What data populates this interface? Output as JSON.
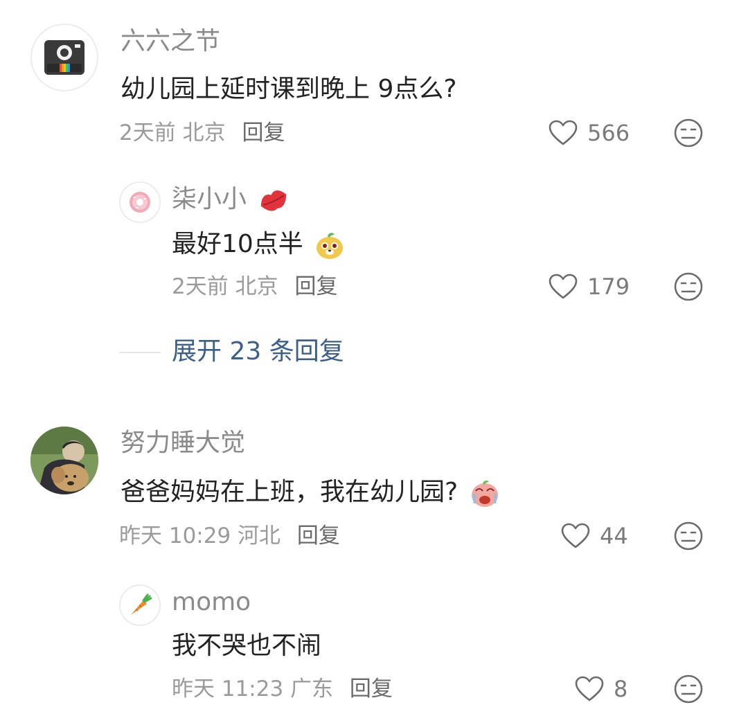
{
  "comments": [
    {
      "user": "六六之节",
      "text": "幼儿园上延时课到晚上 9点么?",
      "time": "2天前",
      "location": "北京",
      "reply_label": "回复",
      "likes": "566"
    },
    {
      "user": "柒小小",
      "text": "最好10点半",
      "time": "2天前",
      "location": "北京",
      "reply_label": "回复",
      "likes": "179"
    },
    {
      "user": "努力睡大觉",
      "text": "爸爸妈妈在上班，我在幼儿园?",
      "time": "昨天 10:29",
      "location": "河北",
      "reply_label": "回复",
      "likes": "44"
    },
    {
      "user": "momo",
      "text": "我不哭也不闹",
      "time": "昨天 11:23",
      "location": "广东",
      "reply_label": "回复",
      "likes": "8"
    }
  ],
  "expand_replies": "展开 23 条回复",
  "icons": {
    "like": "heart-outline-icon",
    "dislike": "meh-face-icon"
  },
  "colors": {
    "username": "#8a8a8a",
    "text": "#222222",
    "meta": "#9a9a9a",
    "expand_link": "#3b5f88"
  }
}
